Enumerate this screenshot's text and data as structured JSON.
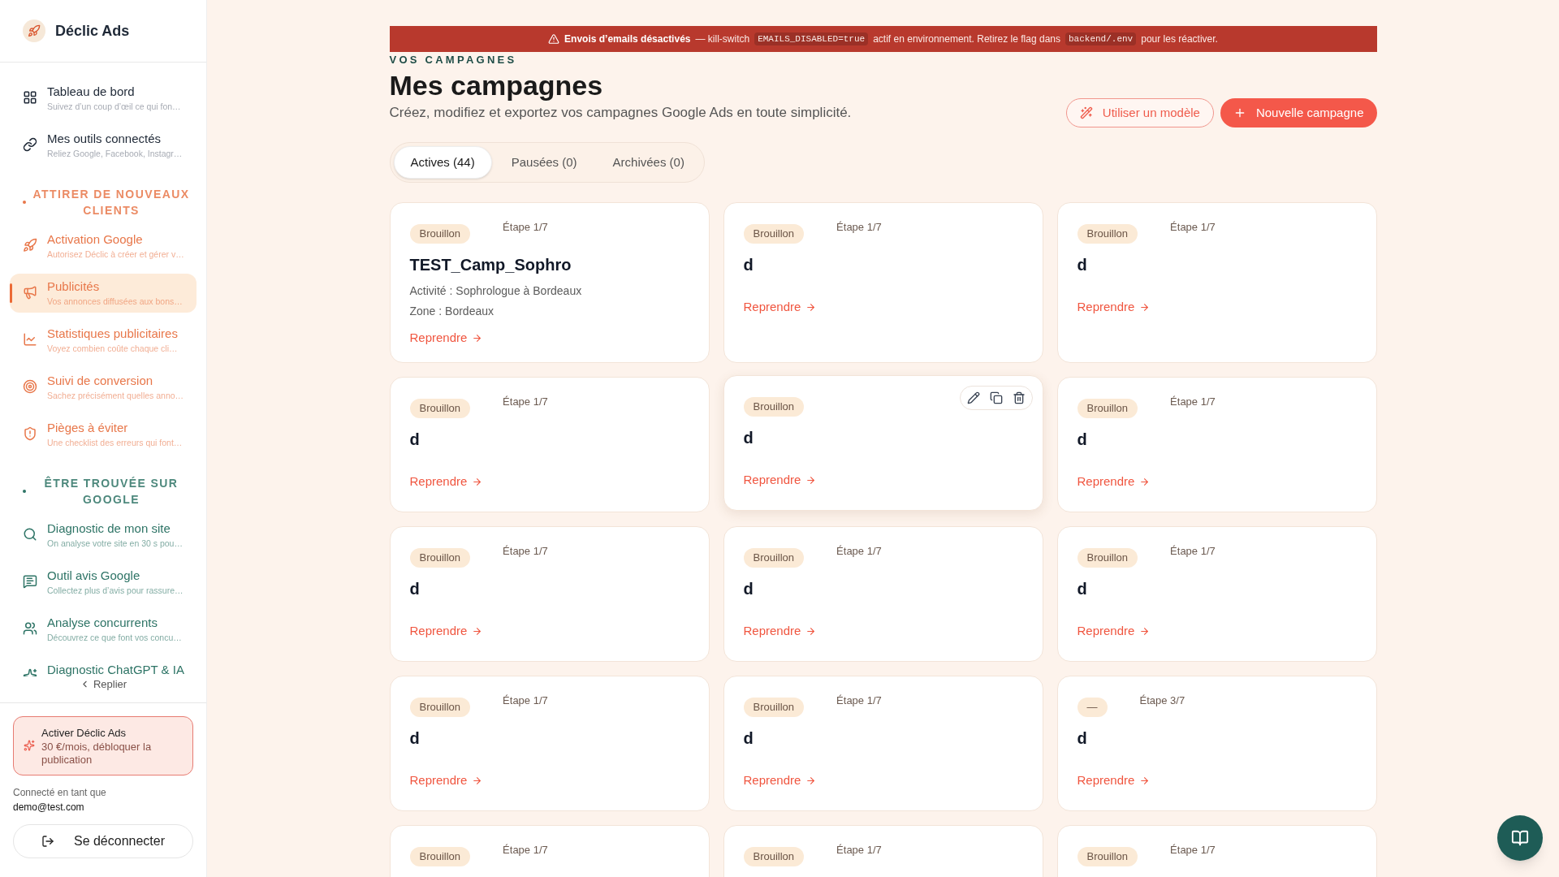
{
  "sidebar": {
    "brand": "Déclic Ads",
    "groups": [
      {
        "items": [
          {
            "title": "Tableau de bord",
            "description": "Suivez d’un coup d’œil ce qui fon…",
            "selected": false
          },
          {
            "title": "Mes outils connectés",
            "description": "Reliez Google, Facebook, Instagr…",
            "selected": false
          }
        ]
      },
      {
        "heading": "ATTIRER DE NOUVEAUX CLIENTS",
        "color": "#e8774a",
        "items": [
          {
            "title": "Activation Google",
            "description": "Autorisez Déclic à créer et gérer v…",
            "selected": false
          },
          {
            "title": "Publicités",
            "description": "Vos annonces diffusées aux bons…",
            "selected": true
          },
          {
            "title": "Statistiques publicitaires",
            "description": "Voyez combien coûte chaque cli…",
            "selected": false
          },
          {
            "title": "Suivi de conversion",
            "description": "Sachez précisément quelles anno…",
            "selected": false
          },
          {
            "title": "Pièges à éviter",
            "description": "Une checklist des erreurs qui font…",
            "selected": false
          }
        ]
      },
      {
        "heading": "ÊTRE TROUVÉE SUR GOOGLE",
        "color": "#2e7466",
        "items": [
          {
            "title": "Diagnostic de mon site",
            "description": "On analyse votre site en 30 s pou…",
            "selected": false
          },
          {
            "title": "Outil avis Google",
            "description": "Collectez plus d’avis pour rassure…",
            "selected": false
          },
          {
            "title": "Analyse concurrents",
            "description": "Découvrez ce que font vos concu…",
            "selected": false
          },
          {
            "title": "Diagnostic ChatGPT & IA",
            "selected": false
          }
        ]
      }
    ],
    "collapse": "Replier",
    "promo": {
      "title": "Activer Déclic Ads",
      "text": "30 €/mois, débloquer la publication"
    },
    "account": {
      "label": "Connecté en tant que",
      "email": "demo@test.com"
    },
    "logout": "Se déconnecter"
  },
  "banner": [
    {
      "kind": "strong",
      "text": "Envois d’emails désactivés"
    },
    {
      "kind": "text",
      "text": "— kill-switch"
    },
    {
      "kind": "code",
      "text": "EMAILS_DISABLED=true"
    },
    {
      "kind": "text",
      "text": "actif en environnement. Retirez le flag dans"
    },
    {
      "kind": "code",
      "text": "backend/.env"
    },
    {
      "kind": "text",
      "text": "pour les réactiver."
    }
  ],
  "header": {
    "eyebrow": "VOS CAMPAGNES",
    "title": "Mes campagnes",
    "subtitle": "Créez, modifiez et exportez vos campagnes Google Ads en toute simplicité.",
    "buttons": [
      {
        "label": "Utiliser un modèle",
        "kind": "outline"
      },
      {
        "label": "Nouvelle campagne",
        "kind": "primary"
      }
    ]
  },
  "tabs": [
    {
      "label": "Actives (44)",
      "selected": true
    },
    {
      "label": "Pausées (0)",
      "selected": false
    },
    {
      "label": "Archivées (0)",
      "selected": false
    }
  ],
  "cards": [
    {
      "badge": "Brouillon",
      "step": "Étape 1/7",
      "title": "TEST_Camp_Sophro",
      "details": [
        "Activité : Sophrologue à Bordeaux",
        "Zone : Bordeaux"
      ],
      "link": "Reprendre",
      "hovered": false
    },
    {
      "badge": "Brouillon",
      "step": "Étape 1/7",
      "title": "d",
      "link": "Reprendre",
      "hovered": false
    },
    {
      "badge": "Brouillon",
      "step": "Étape 1/7",
      "title": "d",
      "link": "Reprendre",
      "hovered": false
    },
    {
      "badge": "Brouillon",
      "step": "Étape 1/7",
      "title": "d",
      "link": "Reprendre",
      "hovered": false
    },
    {
      "badge": "Brouillon",
      "title": "d",
      "link": "Reprendre",
      "hovered": true
    },
    {
      "badge": "Brouillon",
      "step": "Étape 1/7",
      "title": "d",
      "link": "Reprendre",
      "hovered": false
    },
    {
      "badge": "Brouillon",
      "step": "Étape 1/7",
      "title": "d",
      "link": "Reprendre",
      "hovered": false
    },
    {
      "badge": "Brouillon",
      "step": "Étape 1/7",
      "title": "d",
      "link": "Reprendre",
      "hovered": false
    },
    {
      "badge": "Brouillon",
      "step": "Étape 1/7",
      "title": "d",
      "link": "Reprendre",
      "hovered": false
    },
    {
      "badge": "Brouillon",
      "step": "Étape 1/7",
      "title": "d",
      "link": "Reprendre",
      "hovered": false
    },
    {
      "badge": "Brouillon",
      "step": "Étape 1/7",
      "title": "d",
      "link": "Reprendre",
      "hovered": false
    },
    {
      "badge": "—",
      "step": "Étape 3/7",
      "title": "d",
      "link": "Reprendre",
      "hovered": false
    },
    {
      "badge": "Brouillon",
      "step": "Étape 1/7",
      "hovered": false
    },
    {
      "badge": "Brouillon",
      "step": "Étape 1/7",
      "hovered": false
    },
    {
      "badge": "Brouillon",
      "step": "Étape 1/7",
      "hovered": false
    }
  ]
}
